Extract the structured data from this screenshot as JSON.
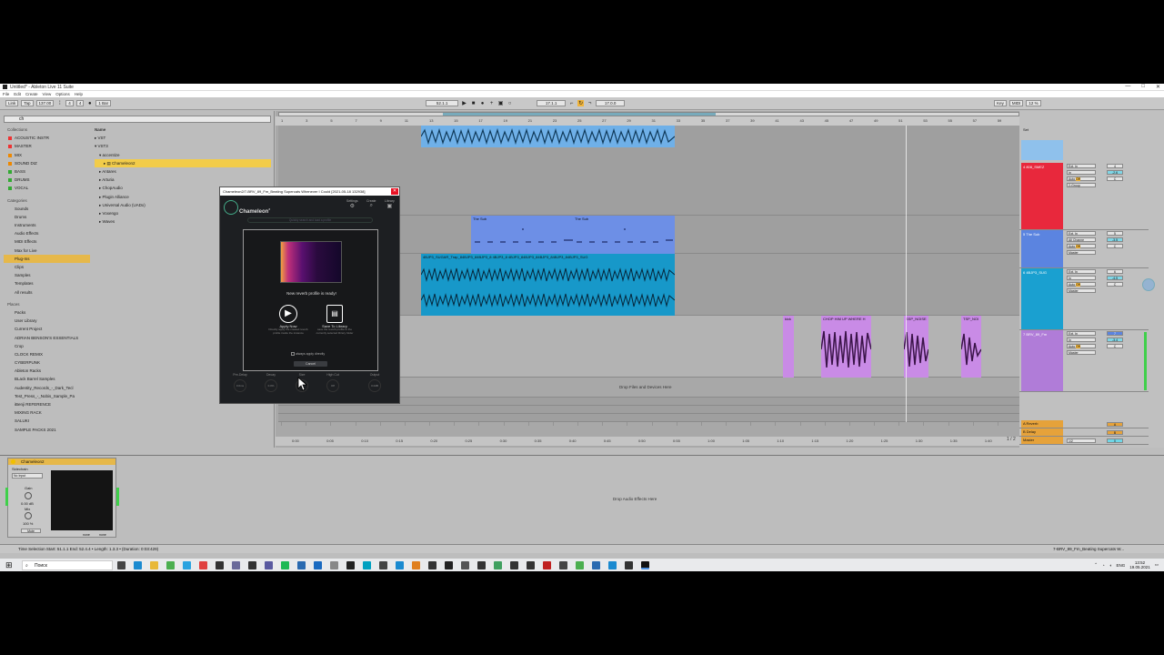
{
  "window": {
    "title": "Untitled* - Ableton Live 11 Suite",
    "menu": [
      "File",
      "Edit",
      "Create",
      "View",
      "Options",
      "Help"
    ],
    "controls": [
      "—",
      "□",
      "✕"
    ]
  },
  "transport": {
    "link": "Link",
    "tap": "Tap",
    "tempo": "137.00",
    "sig_num": "4",
    "sig_den": "4",
    "quantize": "1 Bar",
    "position": "52.1.1",
    "loop_start": "17.1.1",
    "loop_length": "17.0.0",
    "key": "Key",
    "midi": "MIDI",
    "cpu": "12 %"
  },
  "browser": {
    "search_value": "ch",
    "collections_header": "Collections",
    "collections": [
      {
        "label": "ACOUSTIC INSTR",
        "color": "#e33"
      },
      {
        "label": "MASTER",
        "color": "#e33"
      },
      {
        "label": "MIX",
        "color": "#e80"
      },
      {
        "label": "SOUND DIZ",
        "color": "#e80"
      },
      {
        "label": "BASS",
        "color": "#3a3"
      },
      {
        "label": "DRUMS",
        "color": "#3a3"
      },
      {
        "label": "VOCAL",
        "color": "#3a3"
      }
    ],
    "categories_header": "Categories",
    "categories": [
      "Sounds",
      "Drums",
      "Instruments",
      "Audio Effects",
      "MIDI Effects",
      "Max for Live",
      "Plug-Ins",
      "Clips",
      "Samples",
      "Templates",
      "All results"
    ],
    "selected_category": "Plug-Ins",
    "places_header": "Places",
    "places": [
      "Packs",
      "User Library",
      "Current Project",
      "ADRIAN BENSON'S ESSENTIALS",
      "Crop",
      "CLOCK REMIX",
      "CYBERPUNK",
      "Ableton Racks",
      "BLack Barrel Samples",
      "Audentity_Records_-_Dark_Tecl",
      "Test_Press_-_Nobis_Sample_Pa",
      "iBenji REFERENCE",
      "MIXING RACK",
      "SALUKI",
      "SAMPLE PACKS 2021"
    ],
    "names_header": "Name",
    "names": [
      "VST",
      "VST3",
      "accentize",
      "Chameleon2",
      "Antares",
      "Arturia",
      "ChopAudio",
      "Plugin Alliance",
      "Universal Audio (UADx)",
      "Voxengo",
      "Waves"
    ],
    "selected_name": "Chameleon2"
  },
  "ruler": {
    "bars": [
      "1",
      "3",
      "5",
      "7",
      "9",
      "11",
      "13",
      "15",
      "17",
      "19",
      "21",
      "23",
      "25",
      "27",
      "29",
      "31",
      "33",
      "35",
      "37",
      "39",
      "41",
      "43",
      "45",
      "47",
      "49",
      "51",
      "53",
      "55",
      "57",
      "59"
    ],
    "times": [
      "0:00",
      "0:05",
      "0:10",
      "0:15",
      "0:20",
      "0:25",
      "0:30",
      "0:35",
      "0:40",
      "0:45",
      "0:50",
      "0:55",
      "1:00",
      "1:05",
      "1:10",
      "1:15",
      "1:20",
      "1:25",
      "1:30",
      "1:35",
      "1:40"
    ],
    "drop_files": "Drop Files and Devices Here"
  },
  "clips": {
    "sub_a": "The Sub",
    "sub_b": "The Sub",
    "drum": "4BJP3_SUGAR_Trap_84BJP3_84BJP3_8 4BJP3_8 4BJP3_84BJP3_84BJP3_84BJP3_84BJP3_SUG",
    "purple_1": "kick",
    "purple_2": "CHOP HIM UP WHERE H",
    "purple_3": "SSP_NOISE",
    "purple_4": "TSP_NOI"
  },
  "mixer": {
    "set": "Set",
    "tracks": [
      {
        "name": "4 808_SMEZ",
        "color": "#e8283c",
        "input": "Ext. In",
        "in": "In",
        "auto": "Auto",
        "off": "Off",
        "group": "2-Group",
        "num": "4",
        "vol": "-2.6",
        "pan": "C"
      },
      {
        "name": "5 The Sub",
        "color": "#5b84e0",
        "input": "Ext. In",
        "in": "All Channe",
        "auto": "Auto",
        "off": "Off",
        "group": "Master",
        "num": "5",
        "vol": "-3.5",
        "pan": "C"
      },
      {
        "name": "6 4BJP3_SUG",
        "color": "#1aa0d0",
        "input": "Ext. In",
        "in": "In",
        "auto": "Auto",
        "off": "Off",
        "group": "Master",
        "num": "6",
        "vol": "-4.5",
        "pan": "C"
      },
      {
        "name": "7 BRV_89_Fm",
        "color": "#b07cd8",
        "input": "Ext. In",
        "in": "In",
        "auto": "Auto",
        "off": "Off",
        "group": "Master",
        "num": "7",
        "vol": "-3.4",
        "pan": "C"
      }
    ],
    "returns": [
      {
        "name": "A Reverb",
        "color": "#e6a23a",
        "num": "A"
      },
      {
        "name": "B Delay",
        "color": "#e6a23a",
        "num": "B"
      },
      {
        "name": "Master",
        "color": "#e6a23a",
        "num": "0",
        "group": "1/2"
      }
    ],
    "page": "1 / 2"
  },
  "device": {
    "name": "Chameleon2",
    "sidechain": "Sidechain",
    "input": "No Input",
    "gain_label": "Gain",
    "gain_value": "0.00 dB",
    "mix_label": "Mix",
    "mix_value": "100 %",
    "mute": "Mute",
    "none1": "none",
    "none2": "none",
    "drop_effects": "Drop Audio Effects Here"
  },
  "status": {
    "selection": "Time Selection   Start: 51.1.1   End: 52.4.4 •   Length: 1.3.3 •   (Duration: 0:03:429)",
    "track": "7-BRV_89_Fm_Beating Supercats W..."
  },
  "plugin": {
    "title": "Chameleon2/7-BRV_89_Fm_Beating Supercats Whenever I Could [2021-05-18 132938]",
    "logo": "Chameleon",
    "logo_sup": "2",
    "nav": [
      "Settings",
      "Create",
      "Library"
    ],
    "search_placeholder": "Quickly search and load a profile",
    "dialog_message": "New reverb profile is ready!",
    "apply_label": "Apply Now",
    "apply_desc": "Directly apply the created reverb profile inside the instance",
    "save_label": "Save To Library",
    "save_desc": "save the reverb profile to the currently selected library folder",
    "always_apply": "always apply directly",
    "cancel": "Cancel",
    "knobs": [
      {
        "label": "Pre-Delay",
        "value": "0.0ms"
      },
      {
        "label": "Decay",
        "value": "0.0%"
      },
      {
        "label": "Size",
        "value": "0"
      },
      {
        "label": "High Cut",
        "value": "Off"
      },
      {
        "label": "Output",
        "value": "0.0dB"
      }
    ]
  },
  "taskbar": {
    "search": "Поиск",
    "lang": "ENG",
    "time": "13:52",
    "date": "19.05.2021"
  }
}
